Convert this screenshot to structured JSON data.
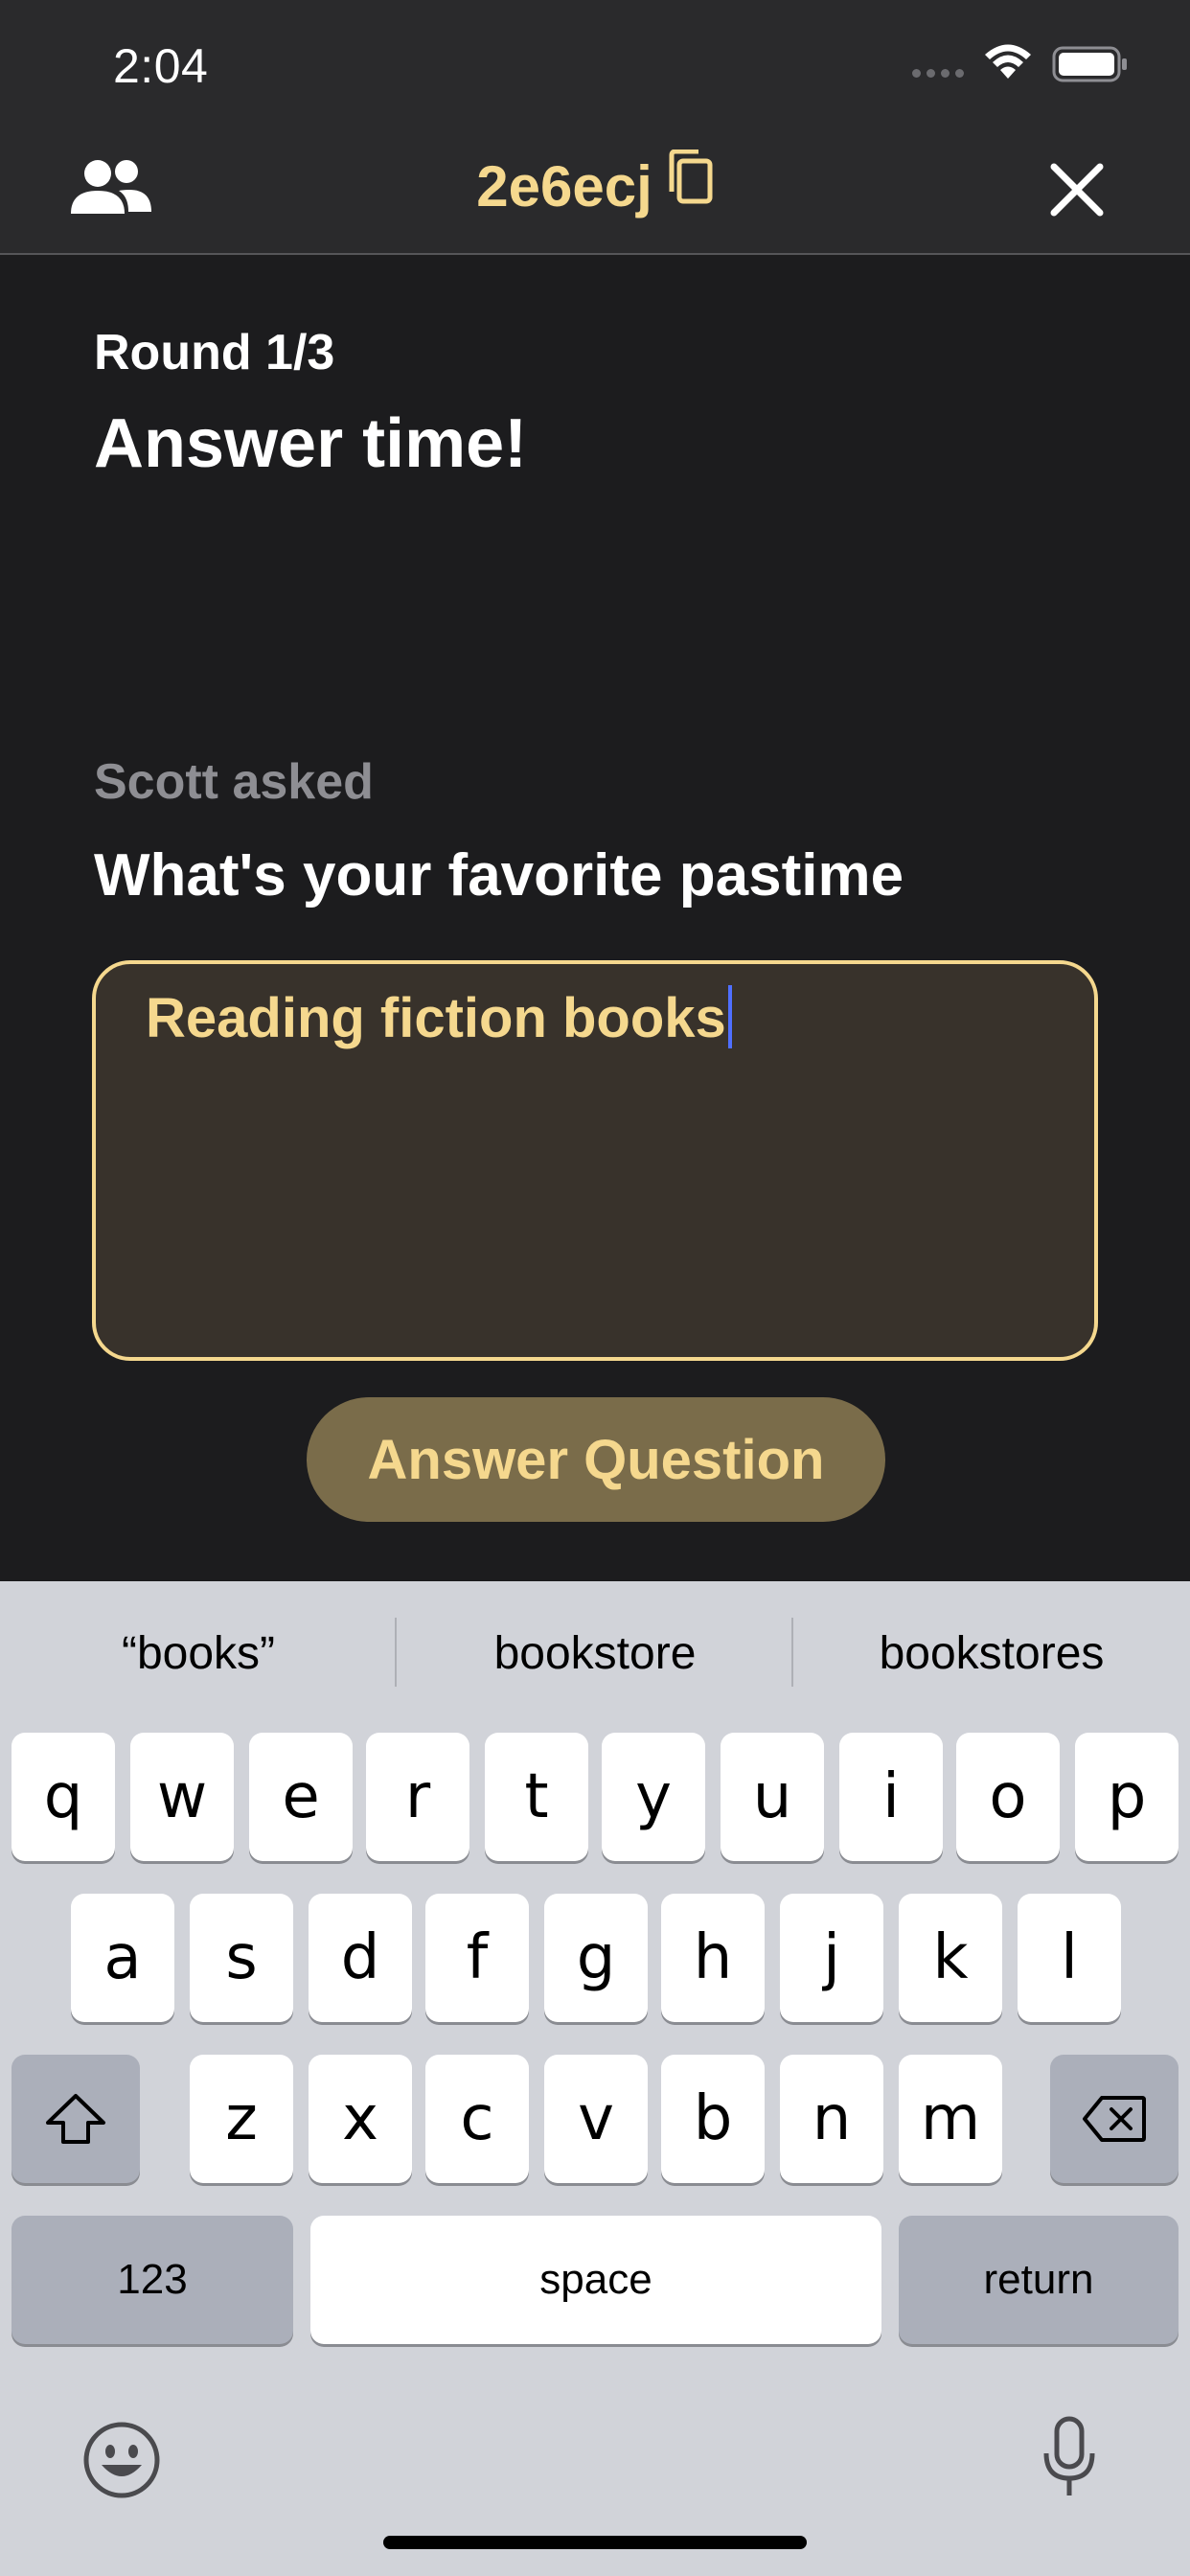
{
  "status_bar": {
    "time": "2:04"
  },
  "header": {
    "room_code": "2e6ecj"
  },
  "round": {
    "label": "Round 1/3",
    "headline": "Answer time!"
  },
  "question": {
    "asked_by": "Scott asked",
    "text": "What's your favorite pastime"
  },
  "answer": {
    "value": "Reading fiction books"
  },
  "answer_button": {
    "label": "Answer Question"
  },
  "keyboard": {
    "suggestions": [
      "“books”",
      "bookstore",
      "bookstores"
    ],
    "row1": [
      "q",
      "w",
      "e",
      "r",
      "t",
      "y",
      "u",
      "i",
      "o",
      "p"
    ],
    "row2": [
      "a",
      "s",
      "d",
      "f",
      "g",
      "h",
      "j",
      "k",
      "l"
    ],
    "row3": [
      "z",
      "x",
      "c",
      "v",
      "b",
      "n",
      "m"
    ],
    "numbers_label": "123",
    "space_label": "space",
    "return_label": "return"
  },
  "colors": {
    "accent": "#f5d88e",
    "background": "#1c1c1e",
    "header": "#2a2a2c",
    "button": "#7a6c4a",
    "caret": "#4f6fff"
  },
  "icons": [
    "players-icon",
    "copy-icon",
    "close-icon",
    "shift-icon",
    "delete-icon",
    "emoji-icon",
    "microphone-icon",
    "wifi-icon",
    "battery-icon"
  ]
}
